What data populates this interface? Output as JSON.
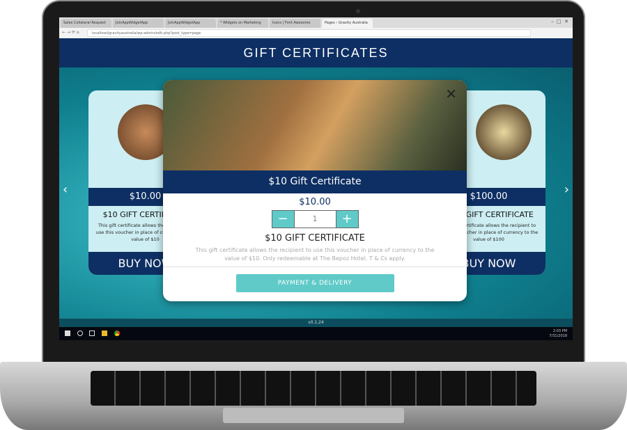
{
  "browser": {
    "tabs": [
      "Sales Collateral Request",
      "JoinAppWidgetApp",
      "JoinAppWidgetApp",
      "* Widgets on Marketing",
      "Icons | Font Awesome",
      "Pages ‹ Gravity Australia"
    ],
    "active_tab": 5,
    "url": "localhost/gravityaustralia/wp-admin/edit.php?post_type=page"
  },
  "header": {
    "title": "GIFT CERTIFICATES"
  },
  "cards": [
    {
      "price": "$10.00",
      "title": "$10 GIFT CERTIFICATE",
      "description": "This gift certificate allows the recipient to use this voucher in place of currency to the value of $10",
      "buy": "BUY NOW"
    },
    {
      "price": "$100.00",
      "title": "$100 GIFT CERTIFICATE",
      "description": "This gift certificate allows the recipient to use this voucher in place of currency to the value of $100",
      "buy": "BUY NOW"
    }
  ],
  "modal": {
    "title": "$10 Gift Certificate",
    "price": "$10.00",
    "quantity": "1",
    "minus": "−",
    "plus": "+",
    "name": "$10 GIFT CERTIFICATE",
    "description": "This gift certificate allows the recipient to use this voucher in place of currency to the value of $10. Only redeemable at The Bepoz Hotel. T & Cs apply.",
    "button": "PAYMENT & DELIVERY",
    "close": "✕"
  },
  "version": "v0.1.24",
  "taskbar": {
    "time": "2:03 PM",
    "date": "7/31/2018"
  },
  "colors": {
    "navy": "#0e2f63",
    "teal": "#5fcac8"
  }
}
